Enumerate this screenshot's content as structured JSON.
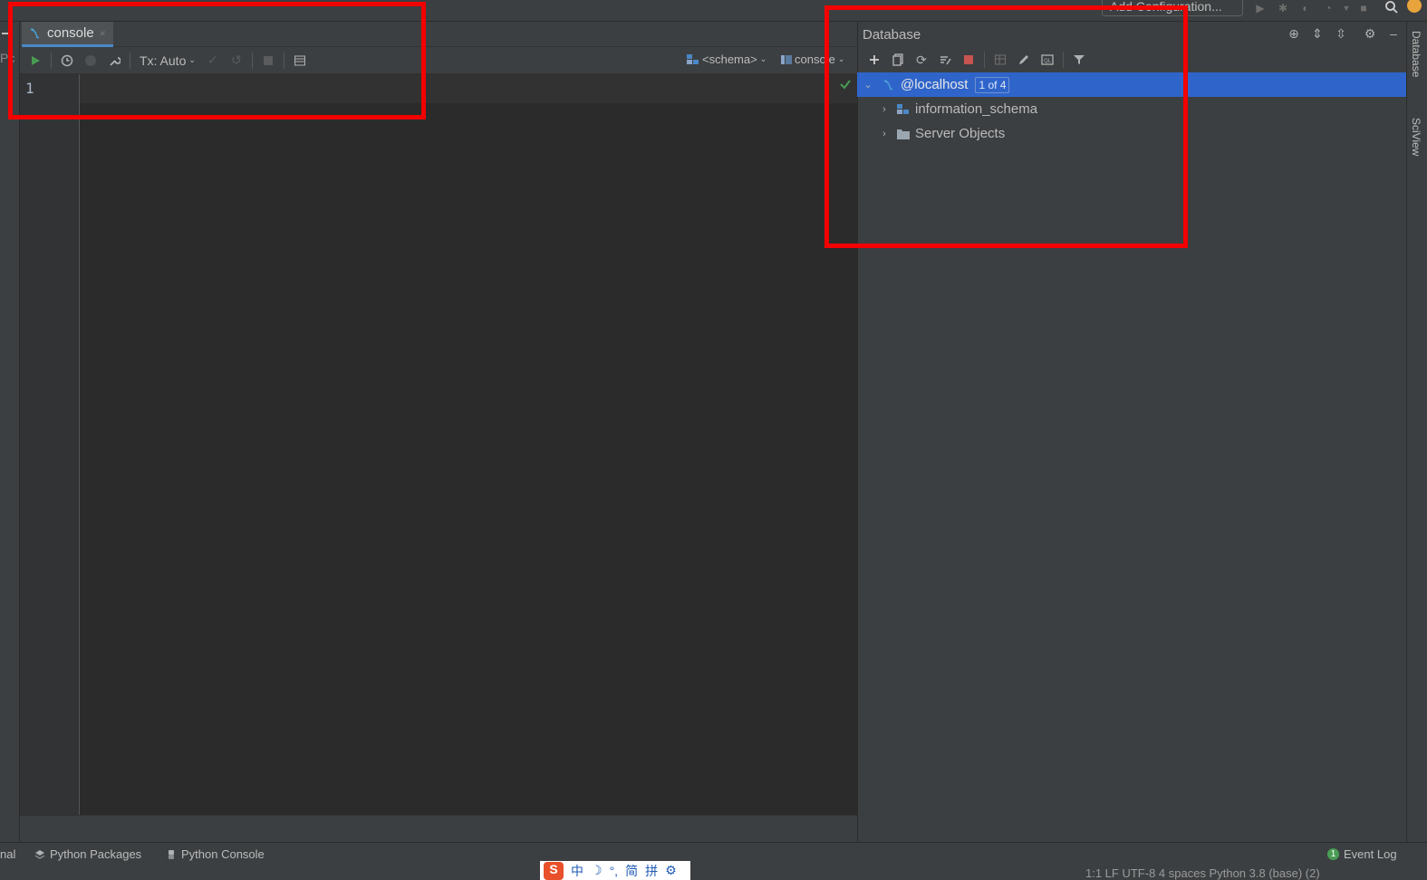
{
  "top_bar": {
    "add_configuration_label": "Add Configuration...",
    "icons": [
      "run-icon",
      "debug-icon",
      "coverage-icon",
      "profile-icon",
      "stop-icon",
      "search-icon"
    ]
  },
  "editor": {
    "left_cut_label": "Pc",
    "tab": {
      "label": "console",
      "close": "×"
    },
    "toolbar": {
      "tx_label": "Tx: Auto",
      "schema_label": "<schema>",
      "console_label": "console"
    },
    "line_numbers": [
      "1"
    ]
  },
  "database": {
    "title": "Database",
    "tree": [
      {
        "label": "@localhost",
        "badge": "1 of 4",
        "expanded": true,
        "selected": true
      },
      {
        "label": "information_schema",
        "expanded": false
      },
      {
        "label": "Server Objects",
        "expanded": false
      }
    ]
  },
  "right_strip": {
    "tabs": [
      "Database",
      "SciView"
    ]
  },
  "bottom_bar": {
    "left_cut": "nal",
    "python_packages": "Python Packages",
    "python_console": "Python Console",
    "event_log_count": "1",
    "event_log": "Event Log"
  },
  "status_bar": {
    "text": "1:1   LF   UTF-8   4 spaces   Python 3.8 (base) (2)"
  },
  "ime": {
    "logo": "S",
    "items": [
      "中",
      "☽",
      "°,",
      "简",
      "拼",
      "⚙"
    ]
  },
  "colors": {
    "selection": "#2f65ca",
    "annotation": "#f30000",
    "run_green": "#499c54",
    "stop_red": "#c75450"
  }
}
